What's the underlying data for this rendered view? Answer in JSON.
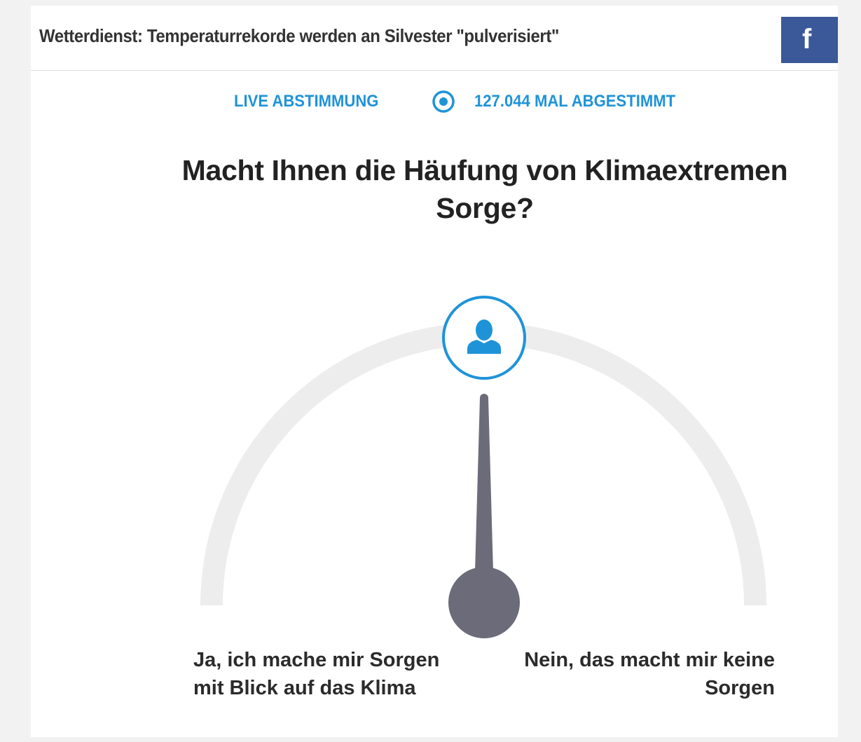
{
  "header": {
    "title": "Wetterdienst: Temperaturrekorde werden an Silvester \"pulverisiert\"",
    "share_icon": "facebook-f-icon",
    "share_color": "#3b5998"
  },
  "poll": {
    "live_label": "LIVE ABSTIMMUNG",
    "live_icon": "radio-dot-icon",
    "vote_count": "127.044 MAL ABGESTIMMT",
    "question": "Macht Ihnen die Häufung von Klimaextremen Sorge?",
    "answer_yes": "Ja, ich mache mir Sorgen mit Blick auf das Klima",
    "answer_no": "Nein, das macht mir keine Sorgen",
    "gauge_value": 0.5,
    "user_icon": "user-icon",
    "accent_color": "#1f93d8",
    "needle_color": "#6b6b7a",
    "track_color": "#ededed"
  }
}
